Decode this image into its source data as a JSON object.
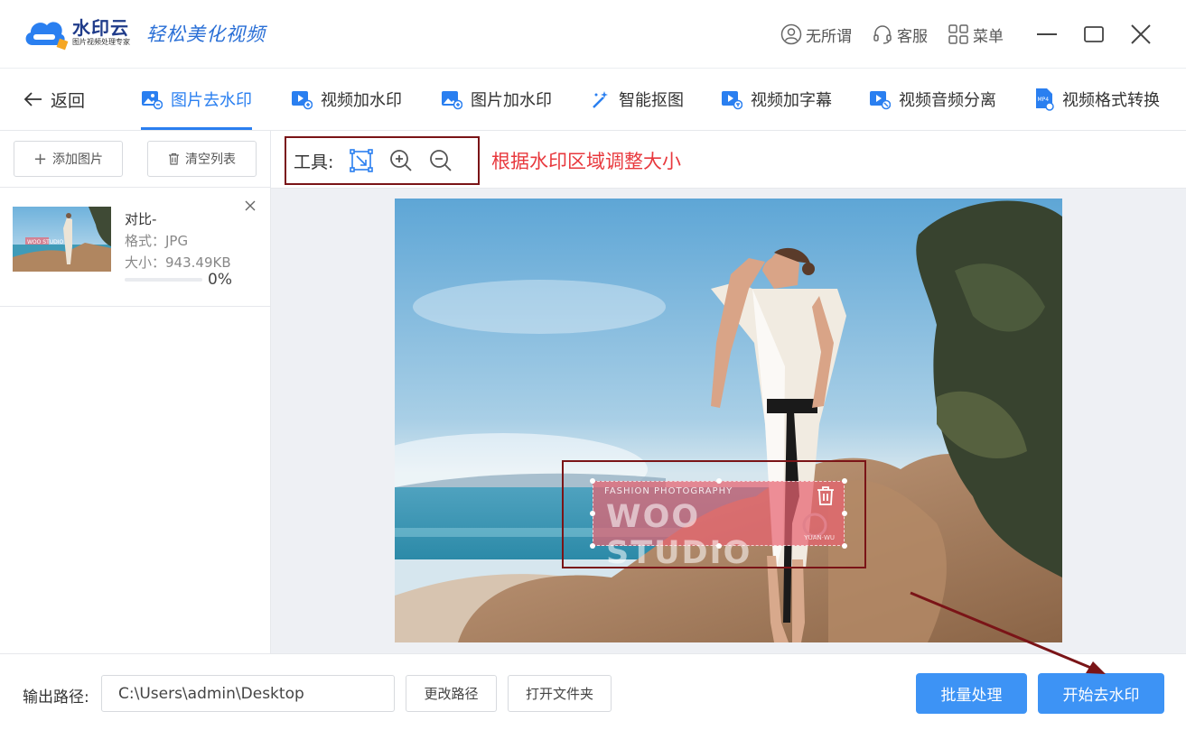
{
  "app": {
    "name": "水印云",
    "subtitle": "图片视频处理专家",
    "slogan": "轻松美化视频",
    "brand_color": "#2a7ff0"
  },
  "top_actions": [
    {
      "label": "无所谓",
      "icon": "user-icon"
    },
    {
      "label": "客服",
      "icon": "headset-icon"
    },
    {
      "label": "菜单",
      "icon": "grid-icon"
    }
  ],
  "window_controls": [
    "minimize-icon",
    "maximize-icon",
    "close-icon"
  ],
  "nav": {
    "back_label": "返回",
    "tabs": [
      {
        "label": "图片去水印",
        "active": true
      },
      {
        "label": "视频加水印"
      },
      {
        "label": "图片加水印"
      },
      {
        "label": "智能抠图"
      },
      {
        "label": "视频加字幕"
      },
      {
        "label": "视频音频分离"
      },
      {
        "label": "视频格式转换"
      }
    ]
  },
  "left_panel": {
    "add_label": "添加图片",
    "clear_label": "清空列表",
    "file": {
      "name": "对比-",
      "format": "格式：JPG",
      "size": "大小：943.49KB",
      "progress": 0,
      "progress_text": "0%"
    }
  },
  "toolbar": {
    "label": "工具:",
    "tools": [
      "select-region-icon",
      "zoom-in-icon",
      "zoom-out-icon"
    ],
    "annotation": "根据水印区域调整大小",
    "annotation_color": "#e8383d"
  },
  "watermark": {
    "small_text": "FASHION PHOTOGRAPHY",
    "big_text": "WOO STUDIO",
    "tiny_text": "YUAN·WU"
  },
  "bottom": {
    "output_label": "输出路径:",
    "output_path": "C:\\Users\\admin\\Desktop",
    "change_path": "更改路径",
    "open_folder": "打开文件夹",
    "batch": "批量处理",
    "start": "开始去水印",
    "primary_color": "#3d93f5"
  }
}
